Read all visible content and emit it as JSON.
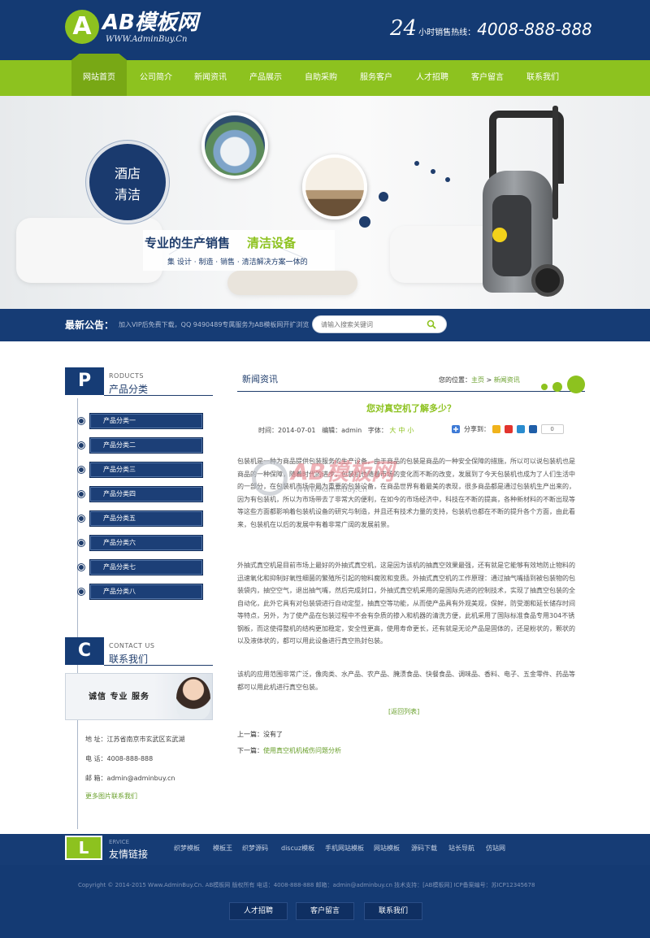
{
  "header": {
    "logo_mark": "A",
    "logo_name": "AB模板网",
    "logo_url": "WWW.AdminBuy.Cn",
    "hotline_24": "24",
    "hotline_label": "小时销售热线：",
    "hotline_number": "4008-888-888"
  },
  "nav": [
    "网站首页",
    "公司简介",
    "新闻资讯",
    "产品展示",
    "自助采购",
    "服务客户",
    "人才招聘",
    "客户留言",
    "联系我们"
  ],
  "banner": {
    "hotel": "酒店",
    "clean": "清洁",
    "slogan_a": "专业的生产销售",
    "slogan_b": "清洁设备",
    "slogan_c": "集 设计 · 制造 · 销售 · 清洁解决方案一体的"
  },
  "notice": {
    "label": "最新公告：",
    "text": "加入VIP后免费下载，QQ 9490489专属服务为AB模板网开扩浏览",
    "search_placeholder": "请输入搜索关键词"
  },
  "sidebar": {
    "products_letter": "P",
    "products_en": "RODUCTS",
    "products_cn": "产品分类",
    "categories": [
      "产品分类一",
      "产品分类二",
      "产品分类三",
      "产品分类四",
      "产品分类五",
      "产品分类六",
      "产品分类七",
      "产品分类八"
    ],
    "contact_letter": "C",
    "contact_en": "CONTACT US",
    "contact_cn": "联系我们",
    "contact_banner": "诚信  专业  服务",
    "address": "地    址：江苏省南京市玄武区玄武湖",
    "phone": "电    话：4008-888-888",
    "email": "邮    箱：admin@adminbuy.cn",
    "more": "更多图片联系我们"
  },
  "main": {
    "section_title": "新闻资讯",
    "crumb_label": "您的位置：",
    "crumb_home": "主页",
    "crumb_current": "新闻资讯",
    "article_title": "您对真空机了解多少？",
    "time": "时间：2014-07-01",
    "editor": "编辑：admin",
    "font_label": "字体：",
    "font_sizes": [
      "大",
      "中",
      "小"
    ],
    "share_label": "分享到：",
    "share_count": "0",
    "para1": "包装机是一种为商品提供包装服务的生产设备，由于商品的包装是商品的一种安全保障的措施，所以可以说包装机也是商品的一种保障，随着时代的进步，包装机也随着市场的变化而不断的改变，发展到了今天包装机也成为了人们生活中的一部分，在包装机市场中最为重要的包装设备，在商品世界有着最美的表现，很多商品都是通过包装机生产出来的，因为有包装机，所以为市场带去了非常大的便利，在如今的市场经济中，科技在不断的提高，各种新材料的不断出现等等这些方面都影响着包装机设备的研究与制造，并且还有技术力量的支持，包装机也都在不断的提升各个方面，由此看来，包装机在以后的发展中有着非常广阔的发展前景。",
    "para2": "外抽式真空机是目前市场上最好的外抽式真空机，这是因为该机的抽真空效果最强，还有就是它能够有效地防止物料的迅速氧化和抑制好氧性细菌的繁殖所引起的物料腐败和变质。外抽式真空机的工作原理：通过抽气嘴插到被包装物的包装袋内，抽空空气，退出抽气嘴，然后完成封口，外抽式真空机采用的是国际先进的控制技术，实现了抽真空包装的全自动化，此外它具有对包装袋进行自动定型，抽真空等功能，从而使产品具有外观美观，保鲜，防受潮和延长储存时间等特点，另外，为了使产品在包装过程中不会有杂质的掺入和机器的清洗方便，此机采用了国际标准食品专用304不锈钢板，而这使得整机的结构更加稳定，安全性更高，使用寿命更长，还有就是无论产品是固体的，还是粉状的，颗状的以及液体状的，都可以用此设备进行真空热封包装。",
    "para3": "该机的应用范围非常广泛，像肉类、水产品、农产品、腌渍食品、快餐食品、调味品、香料、电子、五金零件、药品等都可以用此机进行真空包装。",
    "watermark_name": "AB模板网",
    "watermark_url": "WWW.AdminBuy.Cn",
    "back": "[返回列表]",
    "prev_label": "上一篇：",
    "prev_value": "没有了",
    "next_label": "下一篇：",
    "next_value": "使用真空机机械伤问题分析"
  },
  "footer": {
    "letter": "L",
    "en": "ERVICE",
    "cn": "友情链接",
    "links": [
      "织梦模板",
      "模板王",
      "织梦源码",
      "discuz模板",
      "手机网站模板",
      "网站模板",
      "源码下载",
      "站长导航",
      "仿站网"
    ],
    "copyright": "Copyright © 2014-2015 Www.AdminBuy.Cn. AB模板网 版权所有  电话：4008-888-888  邮箱：admin@adminbuy.cn  技术支持：[AB模板网]  ICP备案编号：苏ICP12345678",
    "buttons": [
      "人才招聘",
      "客户留言",
      "联系我们"
    ]
  },
  "colors": {
    "navy": "#143a73",
    "green": "#8dc21f"
  }
}
